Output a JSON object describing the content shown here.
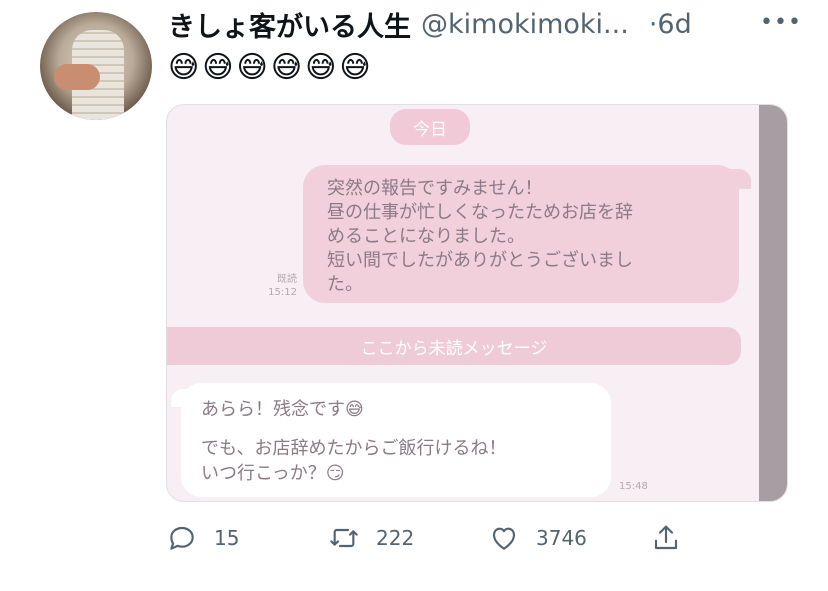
{
  "tweet": {
    "author_name": "きしょ客がいる人生",
    "handle": "@kimokimoki...",
    "separator": "·",
    "time": "6d",
    "more": "•••",
    "text": "😅😅😅😅😅😅"
  },
  "media": {
    "date_label": "今日",
    "outgoing_message": {
      "line1": "突然の報告ですみません！",
      "line2": "昼の仕事が忙しくなったためお店を辞",
      "line3": "めることになりました。",
      "line4": "短い間でしたがありがとうございまし",
      "line5": "た。"
    },
    "read_label": "既読",
    "outgoing_time": "15:12",
    "unread_divider": "ここから未読メッセージ",
    "incoming_message": {
      "line1": "あらら！残念です😅",
      "line2": "でも、お店辞めたからご飯行けるね！",
      "line3": "いつ行こっか？😏"
    },
    "incoming_time": "15:48"
  },
  "actions": {
    "reply_count": "15",
    "retweet_count": "222",
    "like_count": "3746"
  },
  "icons": {
    "reply": "reply-icon",
    "retweet": "retweet-icon",
    "like": "heart-icon",
    "share": "share-icon"
  }
}
